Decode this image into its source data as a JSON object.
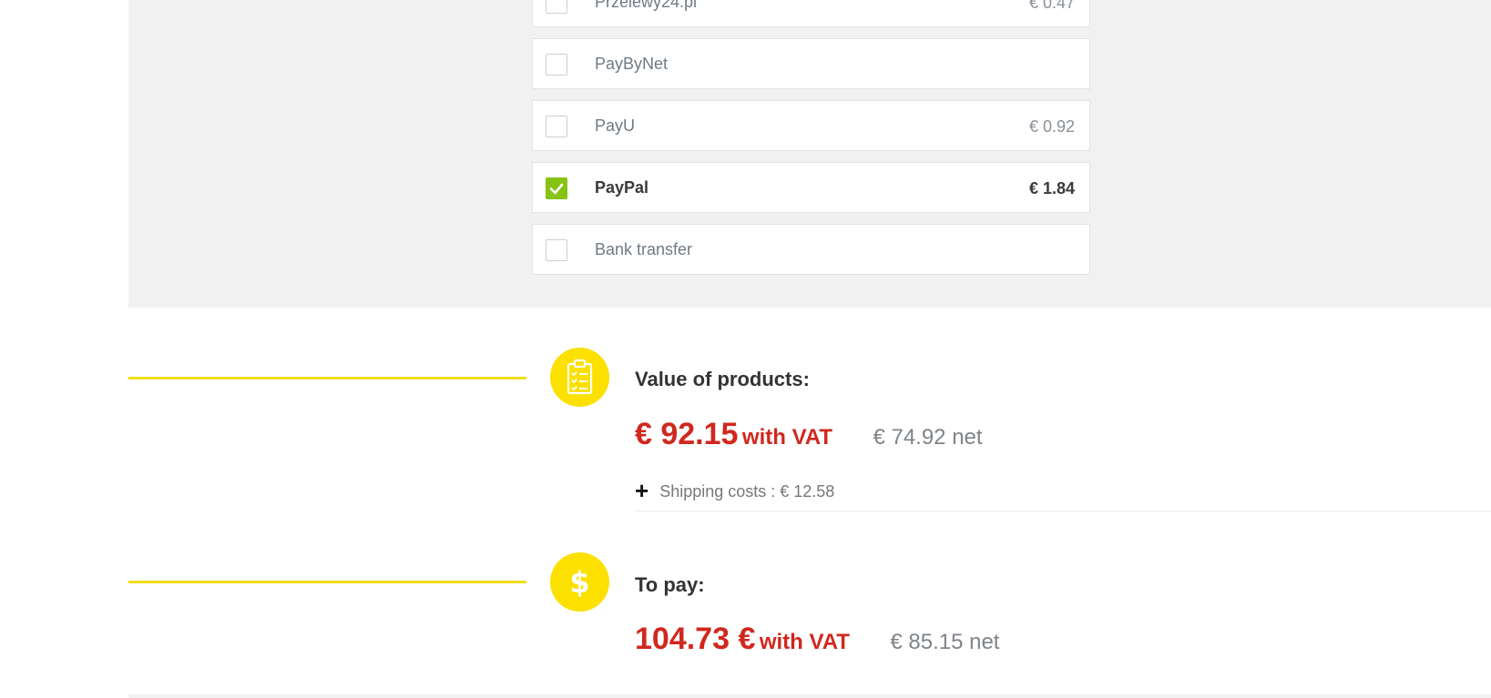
{
  "payment_methods": [
    {
      "name": "Przelewy24.pl",
      "price": "€ 0.47",
      "checked": false
    },
    {
      "name": "PayByNet",
      "price": "",
      "checked": false
    },
    {
      "name": "PayU",
      "price": "€ 0.92",
      "checked": false
    },
    {
      "name": "PayPal",
      "price": "€ 1.84",
      "checked": true
    },
    {
      "name": "Bank transfer",
      "price": "",
      "checked": false
    }
  ],
  "products": {
    "title": "Value of products:",
    "gross": "€ 92.15",
    "gross_suffix": "with VAT",
    "net": "€ 74.92 net",
    "shipping_symbol": "+",
    "shipping": "Shipping costs : € 12.58",
    "icon": "clipboard-checklist-icon"
  },
  "to_pay": {
    "title": "To pay:",
    "gross": "104.73 €",
    "gross_suffix": "with VAT",
    "net": "€ 85.15 net",
    "icon": "dollar-icon"
  },
  "colors": {
    "accent_yellow": "#fbe000",
    "price_red": "#d0281e",
    "checked_green": "#86c314"
  }
}
